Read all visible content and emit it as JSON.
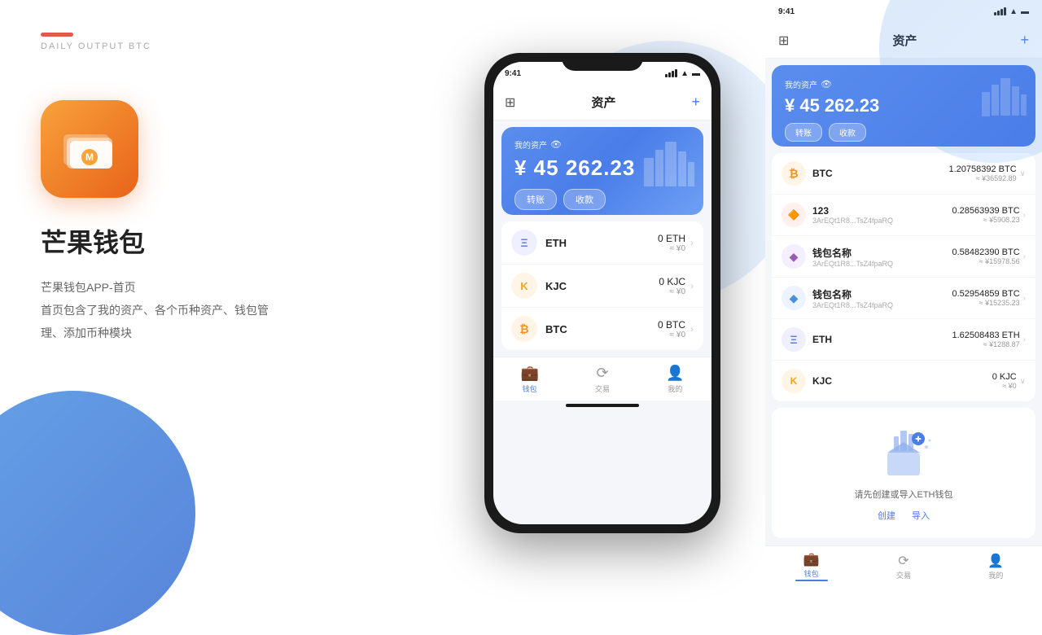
{
  "left": {
    "red_bar": true,
    "app_name": "芒果钱包",
    "app_subtitle": "DAILY OUTPUT BTC",
    "app_title": "芒果钱包",
    "desc_line1": "芒果钱包APP-首页",
    "desc_line2": "首页包含了我的资产、各个币种资产、钱包管",
    "desc_line3": "理、添加币种模块"
  },
  "phone": {
    "status_time": "9:41",
    "nav_title": "资产",
    "add_icon": "+",
    "asset_label": "我的资产",
    "asset_amount": "¥ 45 262.23",
    "transfer_btn": "转账",
    "receive_btn": "收款",
    "coins": [
      {
        "name": "ETH",
        "color": "#627eea",
        "symbol": "Ξ",
        "amount": "0 ETH",
        "approx": "≈ ¥0",
        "bg": "#eef0ff"
      },
      {
        "name": "KJC",
        "color": "#f5a623",
        "symbol": "K",
        "amount": "0 KJC",
        "approx": "≈ ¥0",
        "bg": "#fff5e6"
      },
      {
        "name": "BTC",
        "color": "#f7931a",
        "symbol": "₿",
        "amount": "0 BTC",
        "approx": "≈ ¥0",
        "bg": "#fff5e6"
      }
    ],
    "tabs": [
      {
        "label": "钱包",
        "active": true
      },
      {
        "label": "交易",
        "active": false
      },
      {
        "label": "我的",
        "active": false
      }
    ]
  },
  "right": {
    "status_time": "9:41",
    "nav_title": "资产",
    "asset_label": "我的资产",
    "asset_amount": "¥ 45 262.23",
    "transfer_btn": "转账",
    "receive_btn": "收款",
    "coins": [
      {
        "name": "BTC",
        "color": "#f7931a",
        "symbol": "₿",
        "bg": "#fff5e6",
        "amount": "1.20758392 BTC",
        "approx": "≈ ¥36592.89",
        "addr": ""
      },
      {
        "name": "123",
        "color": "#e05a4e",
        "symbol": "🔶",
        "bg": "#fff0ee",
        "amount": "0.28563939 BTC",
        "approx": "≈ ¥5908.23",
        "addr": "3ArEQt1R8...TsZ4fpaRQ"
      },
      {
        "name": "钱包名称",
        "color": "#9b59b6",
        "symbol": "◆",
        "bg": "#f5eeff",
        "amount": "0.58482390 BTC",
        "approx": "≈ ¥15978.56",
        "addr": "3ArEQt1R8...TsZ4fpaRQ"
      },
      {
        "name": "钱包名称",
        "color": "#4a90d9",
        "symbol": "◆",
        "bg": "#eef4ff",
        "amount": "0.52954859 BTC",
        "approx": "≈ ¥15235.23",
        "addr": "3ArEQt1R8...TsZ4fpaRQ"
      },
      {
        "name": "ETH",
        "color": "#627eea",
        "symbol": "Ξ",
        "bg": "#eef0ff",
        "amount": "1.62508483 ETH",
        "approx": "≈ ¥1288.87",
        "addr": ""
      },
      {
        "name": "KJC",
        "color": "#f5a623",
        "symbol": "K",
        "bg": "#fff5e6",
        "amount": "0 KJC",
        "approx": "≈ ¥0",
        "addr": ""
      }
    ],
    "eth_empty_text": "请先创建或导入ETH钱包",
    "eth_create": "创建",
    "eth_import": "导入",
    "tabs": [
      {
        "label": "钱包",
        "active": true
      },
      {
        "label": "交易",
        "active": false
      },
      {
        "label": "我的",
        "active": false
      }
    ]
  }
}
